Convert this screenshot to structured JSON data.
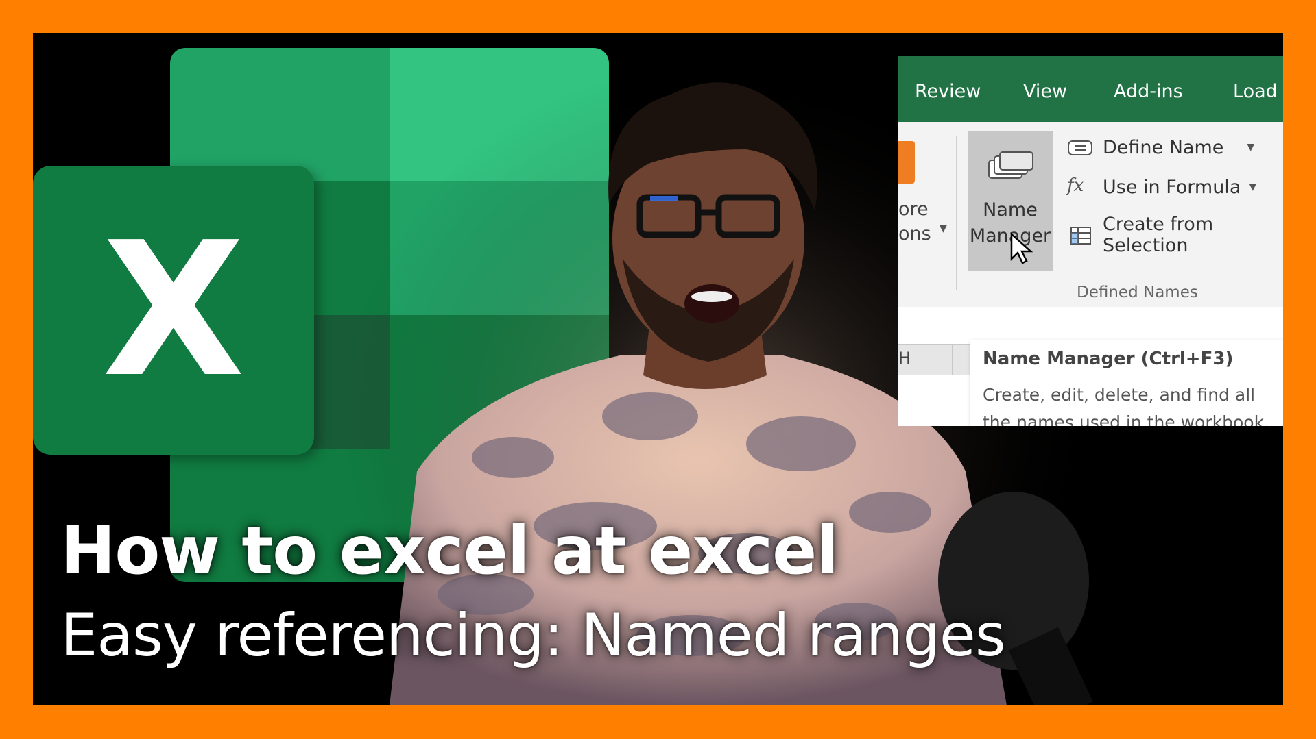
{
  "colors": {
    "border": "#ff7f00",
    "excel_green": "#217346",
    "excel_dark": "#107c41"
  },
  "logo": {
    "letter": "X",
    "icon": "excel-logo"
  },
  "ribbon": {
    "tabs": [
      "Review",
      "View",
      "Add-ins",
      "Load Test"
    ],
    "partial_labels": [
      "ore",
      "ons"
    ],
    "name_manager_lines": [
      "Name",
      "Manager"
    ],
    "commands": [
      {
        "label": "Define Name",
        "icon": "define-name-icon",
        "dropdown": true
      },
      {
        "label": "Use in Formula",
        "icon": "fx-icon",
        "dropdown": true
      },
      {
        "label": "Create from Selection",
        "icon": "create-from-selection-icon",
        "dropdown": false
      }
    ],
    "group_label": "Defined Names",
    "column_fragment": "H"
  },
  "tooltip": {
    "title": "Name Manager (Ctrl+F3)",
    "body": "Create, edit, delete, and find all the names used in the workbook."
  },
  "caption": {
    "line1": "How to excel at excel",
    "line2": "Easy referencing: Named ranges"
  }
}
